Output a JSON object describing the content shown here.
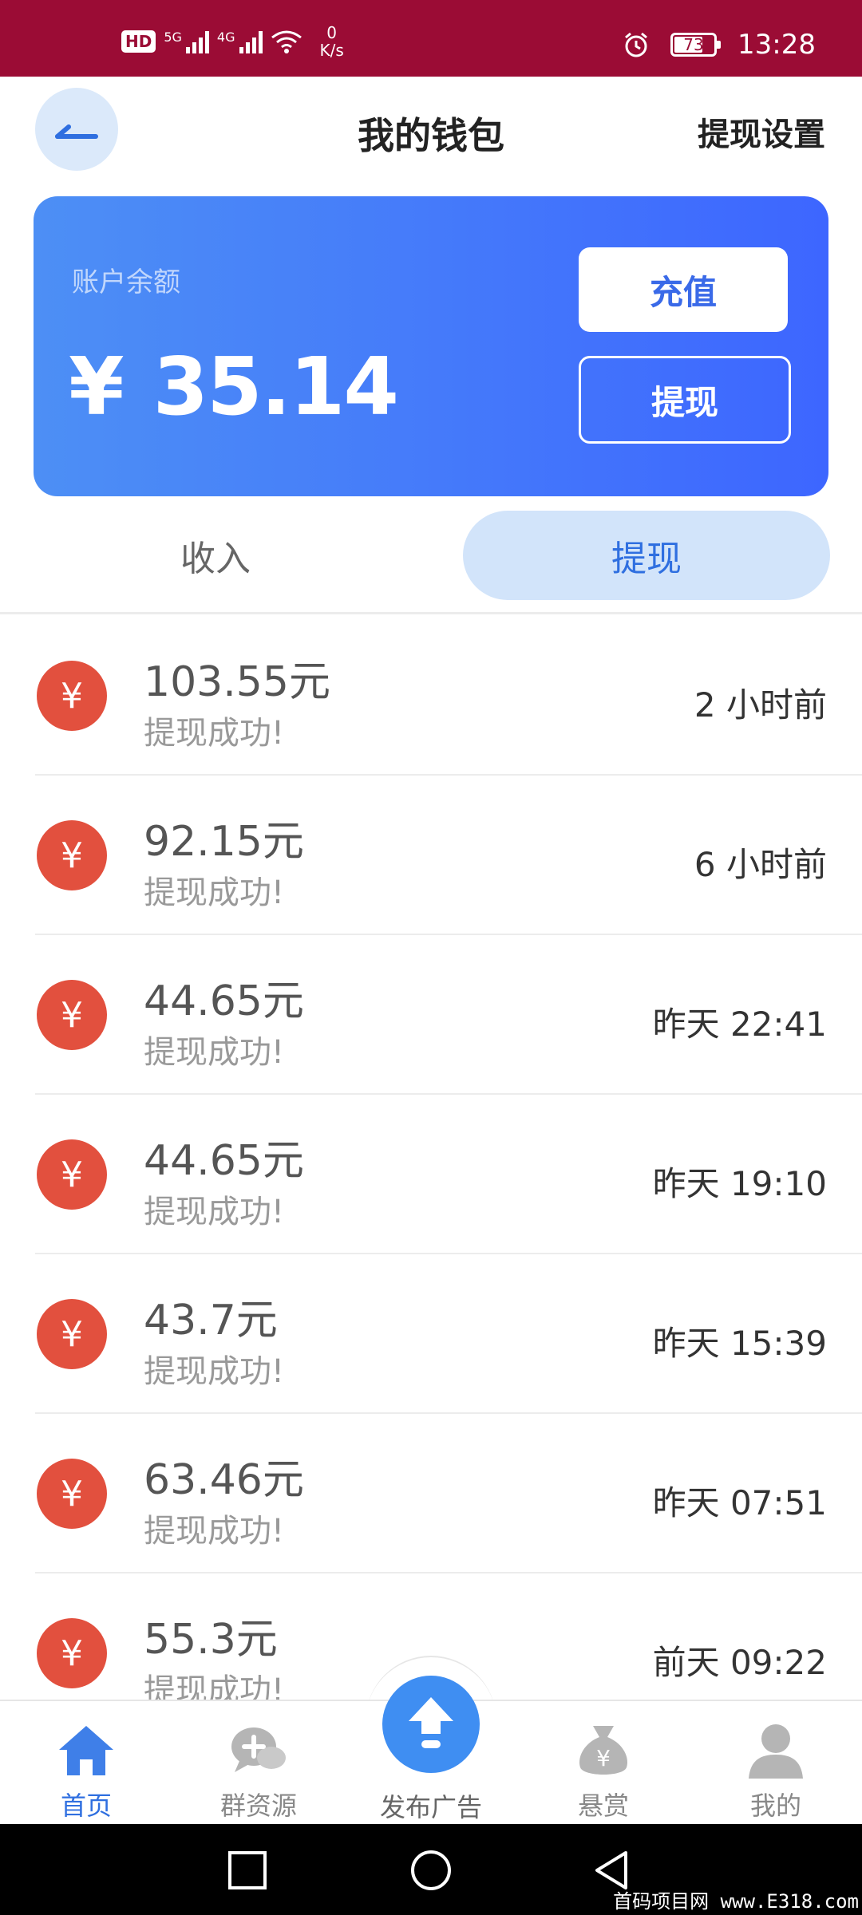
{
  "status_bar": {
    "hd": "HD",
    "net1": "5G",
    "net2": "4G",
    "speed_value": "0",
    "speed_unit": "K/s",
    "battery": "73",
    "battery_level": 0.73,
    "time": "13:28"
  },
  "header": {
    "title": "我的钱包",
    "settings": "提现设置"
  },
  "balance": {
    "label": "账户余额",
    "currency": "¥",
    "amount": "35.14",
    "recharge": "充值",
    "withdraw": "提现"
  },
  "tabs": [
    {
      "label": "收入",
      "active": false
    },
    {
      "label": "提现",
      "active": true
    }
  ],
  "records": [
    {
      "amount": "103.55元",
      "status": "提现成功!",
      "time": "2 小时前"
    },
    {
      "amount": "92.15元",
      "status": "提现成功!",
      "time": "6 小时前"
    },
    {
      "amount": "44.65元",
      "status": "提现成功!",
      "time": "昨天 22:41"
    },
    {
      "amount": "44.65元",
      "status": "提现成功!",
      "time": "昨天 19:10"
    },
    {
      "amount": "43.7元",
      "status": "提现成功!",
      "time": "昨天 15:39"
    },
    {
      "amount": "63.46元",
      "status": "提现成功!",
      "time": "昨天 07:51"
    },
    {
      "amount": "55.3元",
      "status": "提现成功!",
      "time": "前天 09:22"
    }
  ],
  "record_icon": "¥",
  "bottom_nav": {
    "home": "首页",
    "group": "群资源",
    "publish": "发布广告",
    "reward": "悬赏",
    "mine": "我的"
  },
  "watermark": "首码项目网 www.E318.com",
  "colors": {
    "status_bar": "#9b0c35",
    "accent": "#2f6fe0",
    "card_start": "#4d8ff5",
    "card_end": "#3d66ff",
    "record_icon": "#e2503e"
  }
}
